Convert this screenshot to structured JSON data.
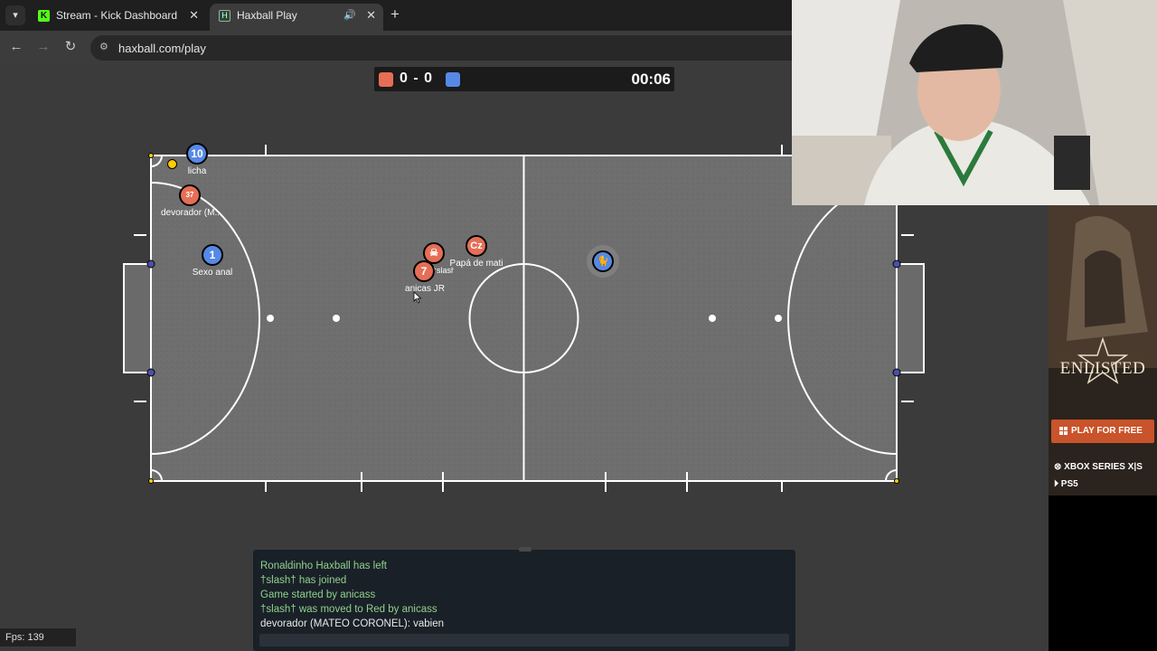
{
  "browser": {
    "tabs": [
      {
        "title": "Stream - Kick Dashboard",
        "favicon": "kick-icon",
        "active": false
      },
      {
        "title": "Haxball Play",
        "favicon": "haxball-icon",
        "active": true
      }
    ],
    "url": "haxball.com/play"
  },
  "scoreboard": {
    "red_score": "0",
    "separator": "-",
    "blue_score": "0",
    "time": "00:06",
    "red_color": "#e56e56",
    "blue_color": "#5689e5"
  },
  "players": [
    {
      "team": "blue",
      "avatar": "10",
      "name": "licha"
    },
    {
      "team": "red",
      "avatar": "37",
      "name": "devorador (M..."
    },
    {
      "team": "blue",
      "avatar": "1",
      "name": "Sexo anal"
    },
    {
      "team": "red",
      "avatar": "☠",
      "name": "†slash†"
    },
    {
      "team": "red",
      "avatar": "Cz",
      "name": "Papá de mati"
    },
    {
      "team": "red",
      "avatar": "7",
      "name": "anicas JR"
    },
    {
      "team": "blue",
      "avatar": "🐈",
      "name": ""
    }
  ],
  "chat": {
    "messages": [
      {
        "text": "Ronaldinho Haxball has left",
        "kind": "notice"
      },
      {
        "text": "†slash† has joined",
        "kind": "notice"
      },
      {
        "text": "Game started by anicass",
        "kind": "notice"
      },
      {
        "text": "†slash† was moved to Red by anicass",
        "kind": "notice"
      },
      {
        "text": "devorador (MATEO CORONEL): vabien",
        "kind": "message"
      }
    ],
    "input_value": ""
  },
  "fps_label": "Fps: 139",
  "ad": {
    "title": "ENLISTED",
    "cta": "PLAY FOR FREE",
    "platform1": "XBOX SERIES X|S",
    "platform2": "PS5"
  }
}
